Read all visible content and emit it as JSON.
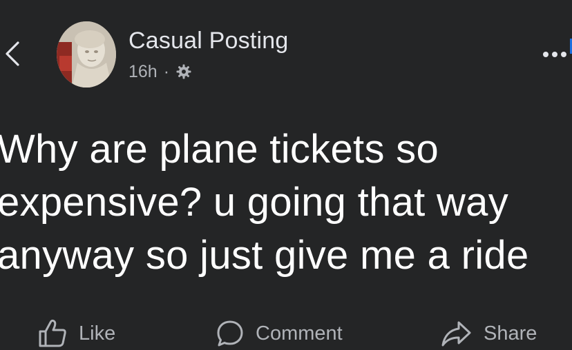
{
  "post": {
    "author": "Casual Posting",
    "time": "16h",
    "separator": "·",
    "audience_icon": "gear-icon",
    "text": "Why are plane tickets so\nexpensive? u going that way\nanyway so just give me a ride"
  },
  "header": {
    "back_icon": "chevron-left-icon",
    "more_icon": "more-dots-icon"
  },
  "actions": {
    "like": "Like",
    "comment": "Comment",
    "share": "Share"
  },
  "colors": {
    "background": "#242526",
    "primary_text": "#ffffff",
    "secondary_text": "#b0b3b8",
    "accent": "#1d6fe0"
  }
}
